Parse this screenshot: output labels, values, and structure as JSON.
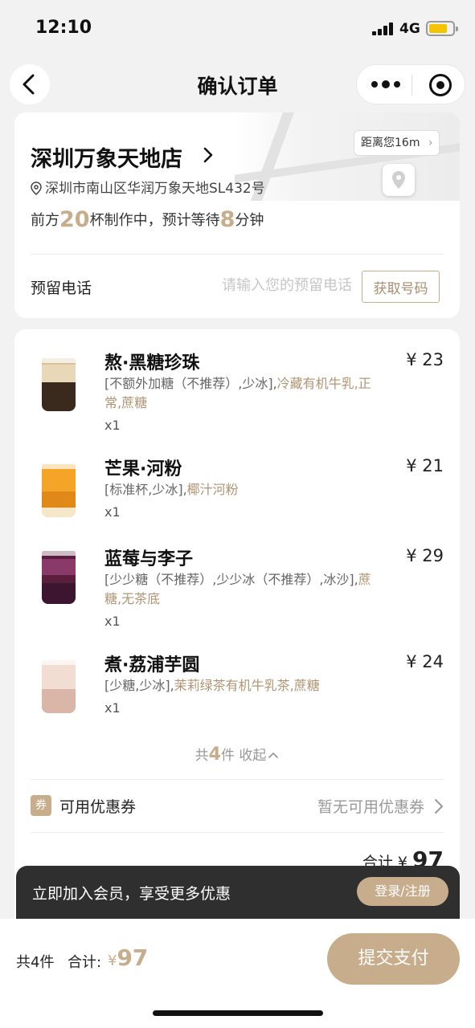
{
  "status_bar": {
    "time": "12:10",
    "network": "4G"
  },
  "nav": {
    "title": "确认订单"
  },
  "store": {
    "name": "深圳万象天地店",
    "address": "深圳市南山区华润万象天地SL432号",
    "distance": "距离您16m",
    "queue_prefix": "前方",
    "queue_cups": "20",
    "queue_mid": "杯制作中，预计等待",
    "wait_minutes": "8",
    "wait_unit": "分钟"
  },
  "phone": {
    "label": "预留电话",
    "placeholder": "请输入您的预留电话",
    "button": "获取号码"
  },
  "items": [
    {
      "name": "熬·黑糖珍珠",
      "price": "¥ 23",
      "spec_plain": "[不额外加糖（不推荐）,少冰],",
      "spec_highlight": "冷藏有机牛乳,正常,蔗糖",
      "qty": "x1"
    },
    {
      "name": "芒果·河粉",
      "price": "¥ 21",
      "spec_plain": "[标准杯,少冰],",
      "spec_highlight": "椰汁河粉",
      "qty": "x1"
    },
    {
      "name": "蓝莓与李子",
      "price": "¥ 29",
      "spec_plain": "[少少糖（不推荐）,少少冰（不推荐）,冰沙],",
      "spec_highlight": "蔗糖,无茶底",
      "qty": "x1"
    },
    {
      "name": "煮·荔浦芋圆",
      "price": "¥ 24",
      "spec_plain": "[少糖,少冰],",
      "spec_highlight": "茉莉绿茶有机牛乳茶,蔗糖",
      "qty": "x1"
    }
  ],
  "summary": {
    "prefix": "共",
    "count": "4",
    "suffix": "件",
    "toggle": "收起"
  },
  "coupon": {
    "badge": "券",
    "label": "可用优惠券",
    "value": "暂无可用优惠券"
  },
  "subtotal": {
    "label": "合计",
    "currency": "¥",
    "amount": "97"
  },
  "member": {
    "text": "立即加入会员，享受更多优惠",
    "button": "登录/注册"
  },
  "bottom": {
    "count": "共4件",
    "total_label": "合计:",
    "currency": "¥",
    "total": "97",
    "pay_button": "提交支付"
  },
  "colors": {
    "accent": "#c8ad8c",
    "dark_banner": "#2f2f2f"
  }
}
